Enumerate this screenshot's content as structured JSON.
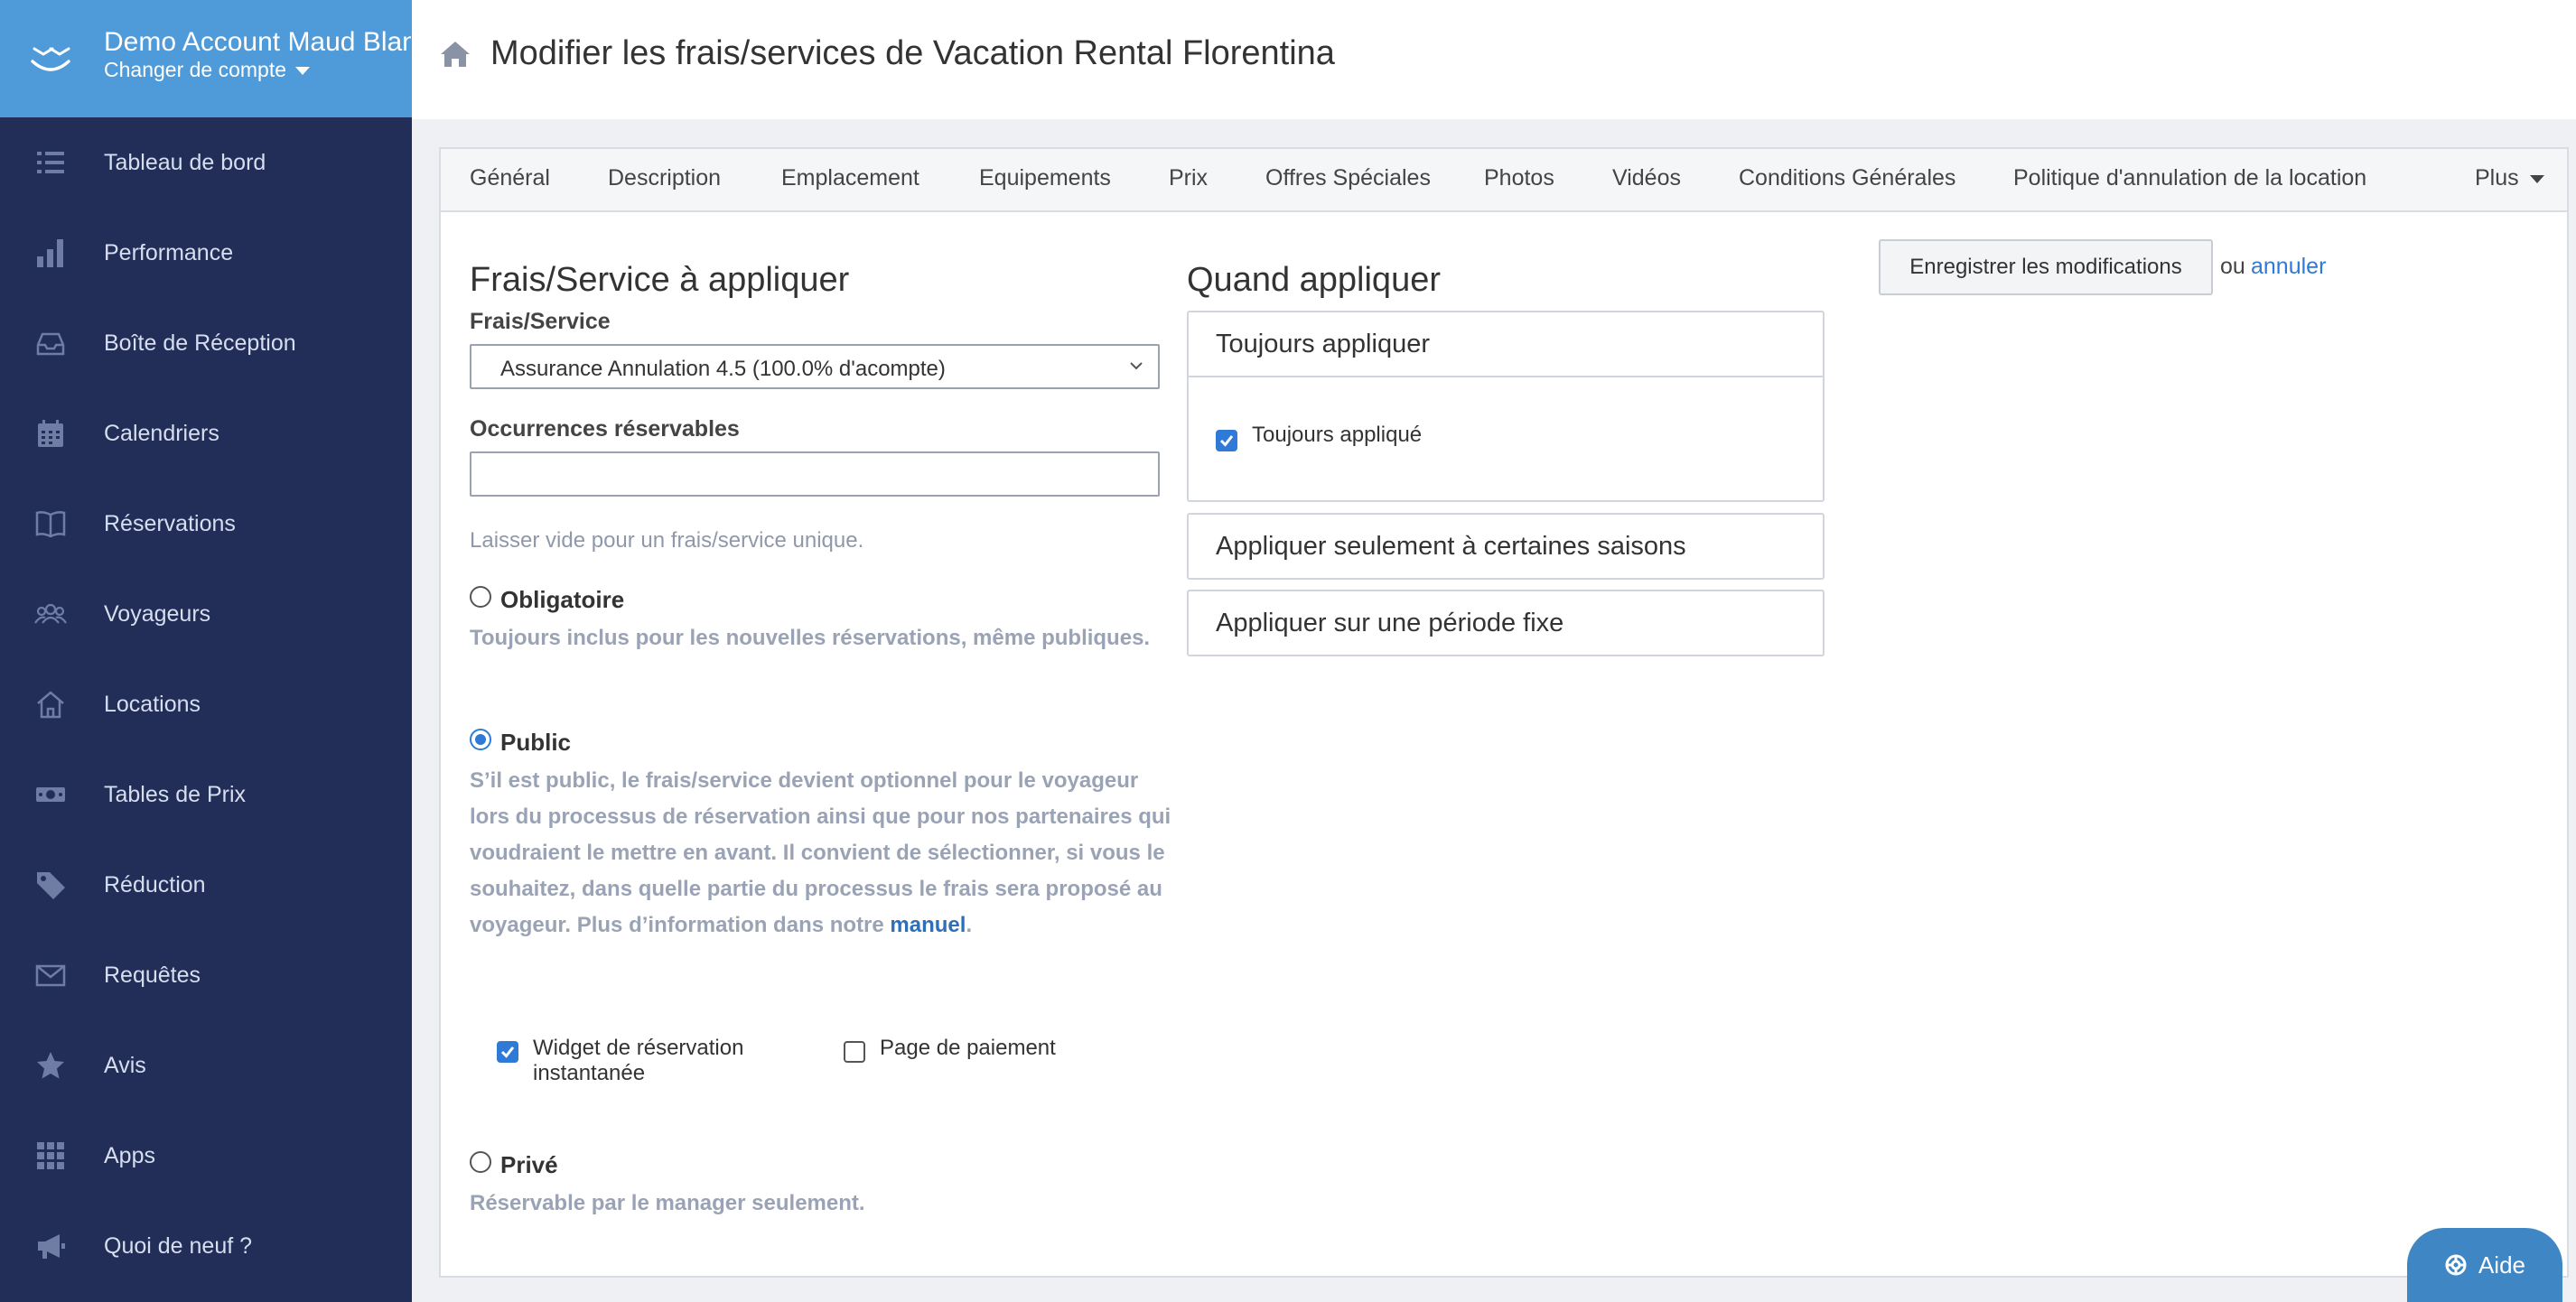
{
  "account": {
    "name": "Demo Account Maud Blan",
    "switch_label": "Changer de compte"
  },
  "sidebar": {
    "items": [
      {
        "label": "Tableau de bord",
        "icon": "list-icon"
      },
      {
        "label": "Performance",
        "icon": "bar-chart-icon"
      },
      {
        "label": "Boîte de Réception",
        "icon": "inbox-icon"
      },
      {
        "label": "Calendriers",
        "icon": "calendar-icon"
      },
      {
        "label": "Réservations",
        "icon": "book-icon"
      },
      {
        "label": "Voyageurs",
        "icon": "users-icon"
      },
      {
        "label": "Locations",
        "icon": "home-icon"
      },
      {
        "label": "Tables de Prix",
        "icon": "money-icon"
      },
      {
        "label": "Réduction",
        "icon": "tag-icon"
      },
      {
        "label": "Requêtes",
        "icon": "envelope-icon"
      },
      {
        "label": "Avis",
        "icon": "star-icon"
      },
      {
        "label": "Apps",
        "icon": "grid-icon"
      },
      {
        "label": "Quoi de neuf ?",
        "icon": "megaphone-icon"
      }
    ]
  },
  "header": {
    "title": "Modifier les frais/services de Vacation Rental Florentina"
  },
  "tabs": [
    {
      "label": "Général"
    },
    {
      "label": "Description"
    },
    {
      "label": "Emplacement"
    },
    {
      "label": "Equipements"
    },
    {
      "label": "Prix"
    },
    {
      "label": "Offres Spéciales"
    },
    {
      "label": "Photos"
    },
    {
      "label": "Vidéos"
    },
    {
      "label": "Conditions Générales"
    },
    {
      "label": "Politique d'annulation de la location"
    },
    {
      "label": "Plus"
    }
  ],
  "form": {
    "section_title": "Frais/Service à appliquer",
    "fee_label": "Frais/Service",
    "fee_value": "Assurance Annulation 4.5 (100.0% d'acompte)",
    "occurrences_label": "Occurrences réservables",
    "occurrences_value": "",
    "occurrences_hint": "Laisser vide pour un frais/service unique.",
    "mandatory": {
      "label": "Obligatoire",
      "desc": "Toujours inclus pour les nouvelles réservations, même publiques.",
      "selected": false
    },
    "public": {
      "label": "Public",
      "desc_before": "S’il est public, le frais/service devient optionnel pour le voyageur lors du processus de réservation ainsi que pour nos partenaires qui voudraient le mettre en avant. Il convient de sélectionner, si vous le souhaitez, dans quelle partie du processus le frais sera proposé au voyageur. Plus d’information dans notre",
      "link": "manuel",
      "desc_after": ".",
      "selected": true,
      "widget_label": "Widget de réservation instantanée",
      "widget_checked": true,
      "payment_label": "Page de paiement",
      "payment_checked": false
    },
    "private": {
      "label": "Privé",
      "desc": "Réservable par le manager seulement.",
      "selected": false
    }
  },
  "when": {
    "title": "Quand appliquer",
    "always": {
      "header": "Toujours appliquer",
      "checkbox_label": "Toujours appliqué",
      "checked": true
    },
    "seasons": {
      "header": "Appliquer seulement à certaines saisons"
    },
    "fixed": {
      "header": "Appliquer sur une période fixe"
    }
  },
  "actions": {
    "save_label": "Enregistrer les modifications",
    "or_label": "ou",
    "cancel_label": "annuler"
  },
  "help": {
    "label": "Aide"
  },
  "colors": {
    "sidebar": "#222e57",
    "account": "#4f9ad8",
    "accent": "#2e7ad6"
  }
}
